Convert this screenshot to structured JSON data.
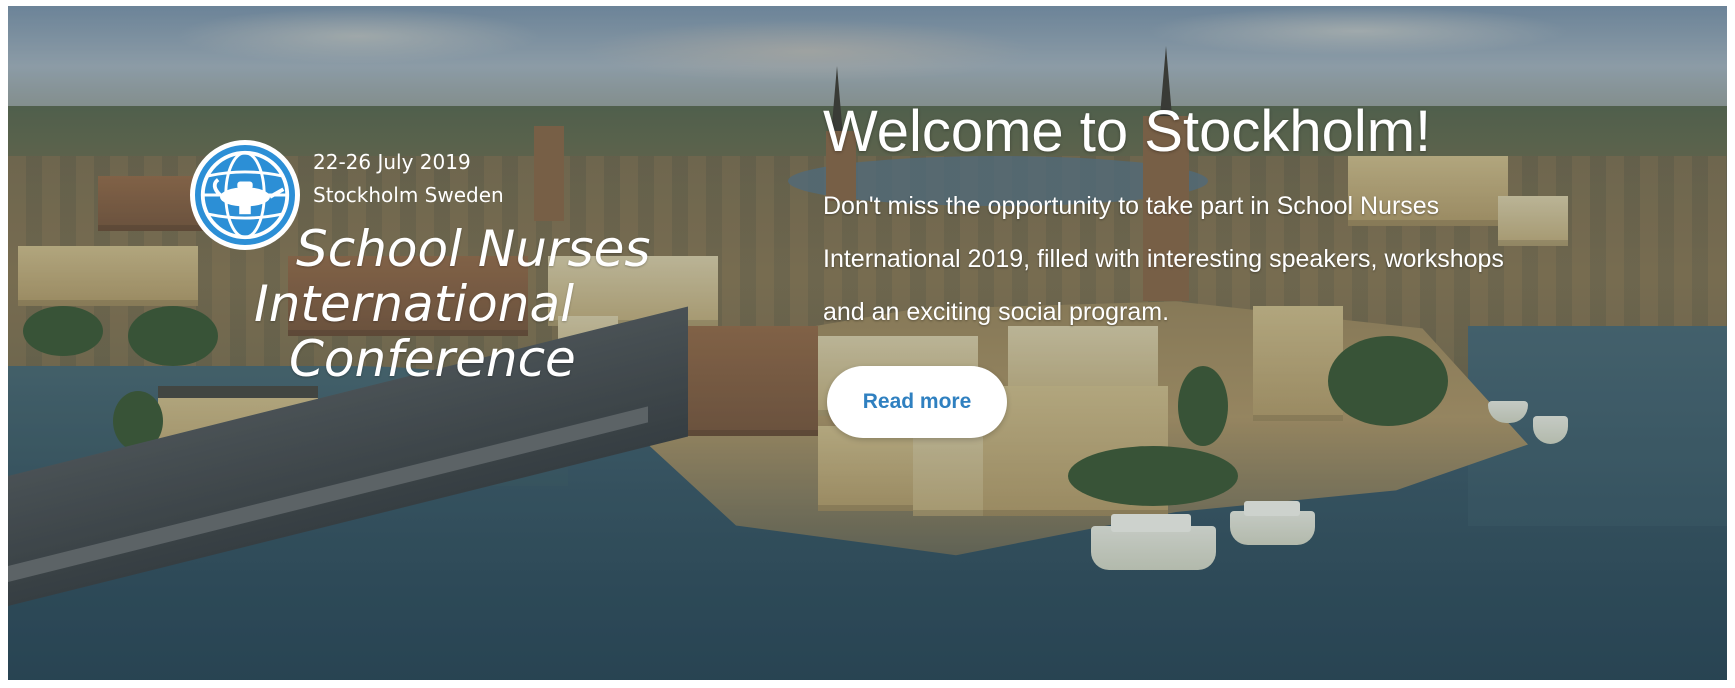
{
  "conference": {
    "dates": "22-26 July 2019",
    "location": "Stockholm Sweden",
    "title_line1": "School Nurses",
    "title_line2": "International",
    "title_line3": "Conference",
    "logo_icon": "lamp-globe-icon"
  },
  "welcome": {
    "heading": "Welcome to Stockholm!",
    "body": "Don't miss the opportunity to take part in School Nurses International 2019, filled with interesting speakers, workshops and an exciting social program.",
    "button_label": "Read more"
  },
  "colors": {
    "logo_blue": "#2c8fd6",
    "button_text": "#2f80c0",
    "text": "#ffffff"
  },
  "background": {
    "description_icon": "stockholm-aerial-photo"
  }
}
